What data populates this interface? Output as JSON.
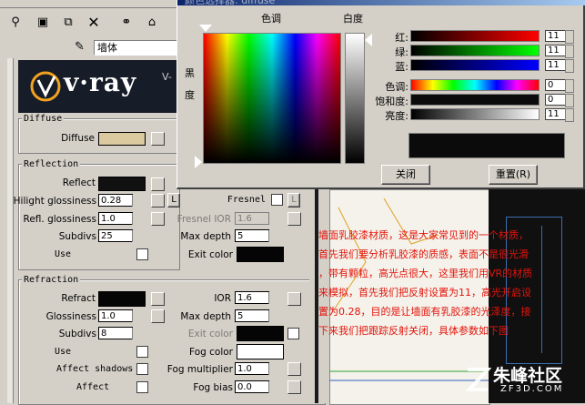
{
  "material": {
    "name": "墙体",
    "logo_text": "v·ray",
    "logo_suffix": "V-"
  },
  "diffuse": {
    "title": "Diffuse",
    "label": "Diffuse",
    "color": "#dbc9a0"
  },
  "reflection": {
    "title": "Reflection",
    "reflect_label": "Reflect",
    "reflect_color": "#111111",
    "hilight_label": "Hilight glossiness",
    "hilight_value": "0.28",
    "l_button": "L",
    "fresnel_label": "Fresnel",
    "refl_gloss_label": "Refl. glossiness",
    "refl_gloss_value": "1.0",
    "fresnel_ior_label": "Fresnel IOR",
    "fresnel_ior_value": "1.6",
    "subdivs_label": "Subdivs",
    "subdivs_value": "25",
    "max_depth_label": "Max depth",
    "max_depth_value": "5",
    "use_label": "Use",
    "exit_color_label": "Exit color",
    "exit_color": "#050505"
  },
  "refraction": {
    "title": "Refraction",
    "refract_label": "Refract",
    "refract_color": "#050505",
    "ior_label": "IOR",
    "ior_value": "1.6",
    "glossiness_label": "Glossiness",
    "glossiness_value": "1.0",
    "max_depth_label": "Max depth",
    "max_depth_value": "5",
    "subdivs_label": "Subdivs",
    "subdivs_value": "8",
    "exit_color_label": "Exit color",
    "use_label": "Use",
    "fog_color_label": "Fog color",
    "fog_color": "#ffffff",
    "affect_shadows_label": "Affect shadows",
    "fog_mult_label": "Fog multiplier",
    "fog_mult_value": "1.0",
    "affect_label": "Affect",
    "fog_bias_label": "Fog bias",
    "fog_bias_value": "0.0"
  },
  "color_picker": {
    "title": "颜色选择器: diffuse",
    "hue_label": "色调",
    "whiteness_label": "白度",
    "blackness_label_1": "黑",
    "blackness_label_2": "度",
    "red_label": "红:",
    "green_label": "绿:",
    "blue_label": "蓝:",
    "hue2_label": "色调:",
    "sat_label": "饱和度:",
    "val_label": "亮度:",
    "red_value": "11",
    "green_value": "11",
    "blue_value": "11",
    "hue_value": "0",
    "sat_value": "0",
    "val_value": "11",
    "close_button": "关闭",
    "reset_button": "重置(R)",
    "preview_color": "#0b0b0b"
  },
  "annotation": {
    "lines": [
      "墙面乳胶漆材质，这是大家常见到的一个材质，",
      "首先我们要分析乳胶漆的质感，表面不是很光滑",
      "，带有颗粒，高光点很大，这里我们用VR的材质",
      "来模拟，首先我们把反射设置为11，高光开启设",
      "置为0.28，目的是让墙面有乳胶漆的光泽度，接",
      "下来我们把跟踪反射关闭，具体参数如下图"
    ]
  },
  "watermark": {
    "brand": "朱峰社区",
    "url": "ZF3D.COM"
  },
  "icons": [
    "pick-icon",
    "put-icon",
    "assign-icon",
    "delete-icon",
    "link-icon",
    "eyedropper-icon"
  ]
}
